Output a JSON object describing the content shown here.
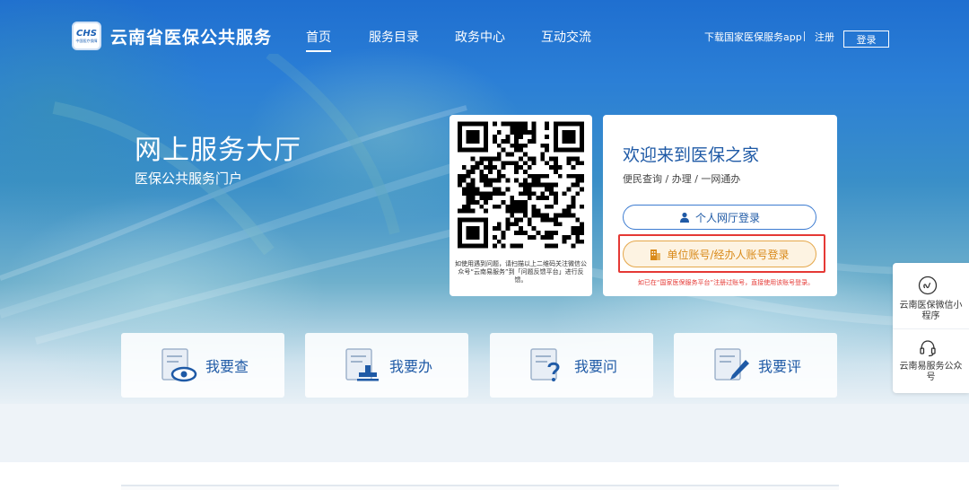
{
  "site": {
    "title": "云南省医保公共服务"
  },
  "nav": {
    "items": [
      "首页",
      "服务目录",
      "政务中心",
      "互动交流"
    ],
    "active_index": 0
  },
  "header_right": {
    "download_app": "下载国家医保服务app",
    "register": "注册",
    "login": "登录"
  },
  "hero": {
    "title": "网上服务大厅",
    "subtitle": "医保公共服务门户"
  },
  "qr_card": {
    "caption": "如使用遇到问题，请扫描以上二维码关注微信公众号“云南易服务”到「问题反馈平台」进行反馈。"
  },
  "welcome_card": {
    "title": "欢迎来到医保之家",
    "subtitle": "便民查询 / 办理 / 一网通办",
    "personal_login": "个人网厅登录",
    "unit_login": "单位账号/经办人账号登录",
    "note": "如已在“国家医保服务平台”注册过账号，直接使用该账号登录。"
  },
  "side_panel": {
    "items": [
      {
        "label": "云南医保微信小程序",
        "icon": "mini-program-icon"
      },
      {
        "label": "云南易服务公众号",
        "icon": "headset-icon"
      }
    ]
  },
  "actions": [
    {
      "label": "我要查",
      "icon": "document-eye-icon"
    },
    {
      "label": "我要办",
      "icon": "document-stamp-icon"
    },
    {
      "label": "我要问",
      "icon": "document-question-icon"
    },
    {
      "label": "我要评",
      "icon": "document-pen-icon"
    }
  ],
  "colors": {
    "brand_blue": "#1f5aa6",
    "accent_orange": "#d98a1a",
    "alert_red": "#e53935"
  }
}
